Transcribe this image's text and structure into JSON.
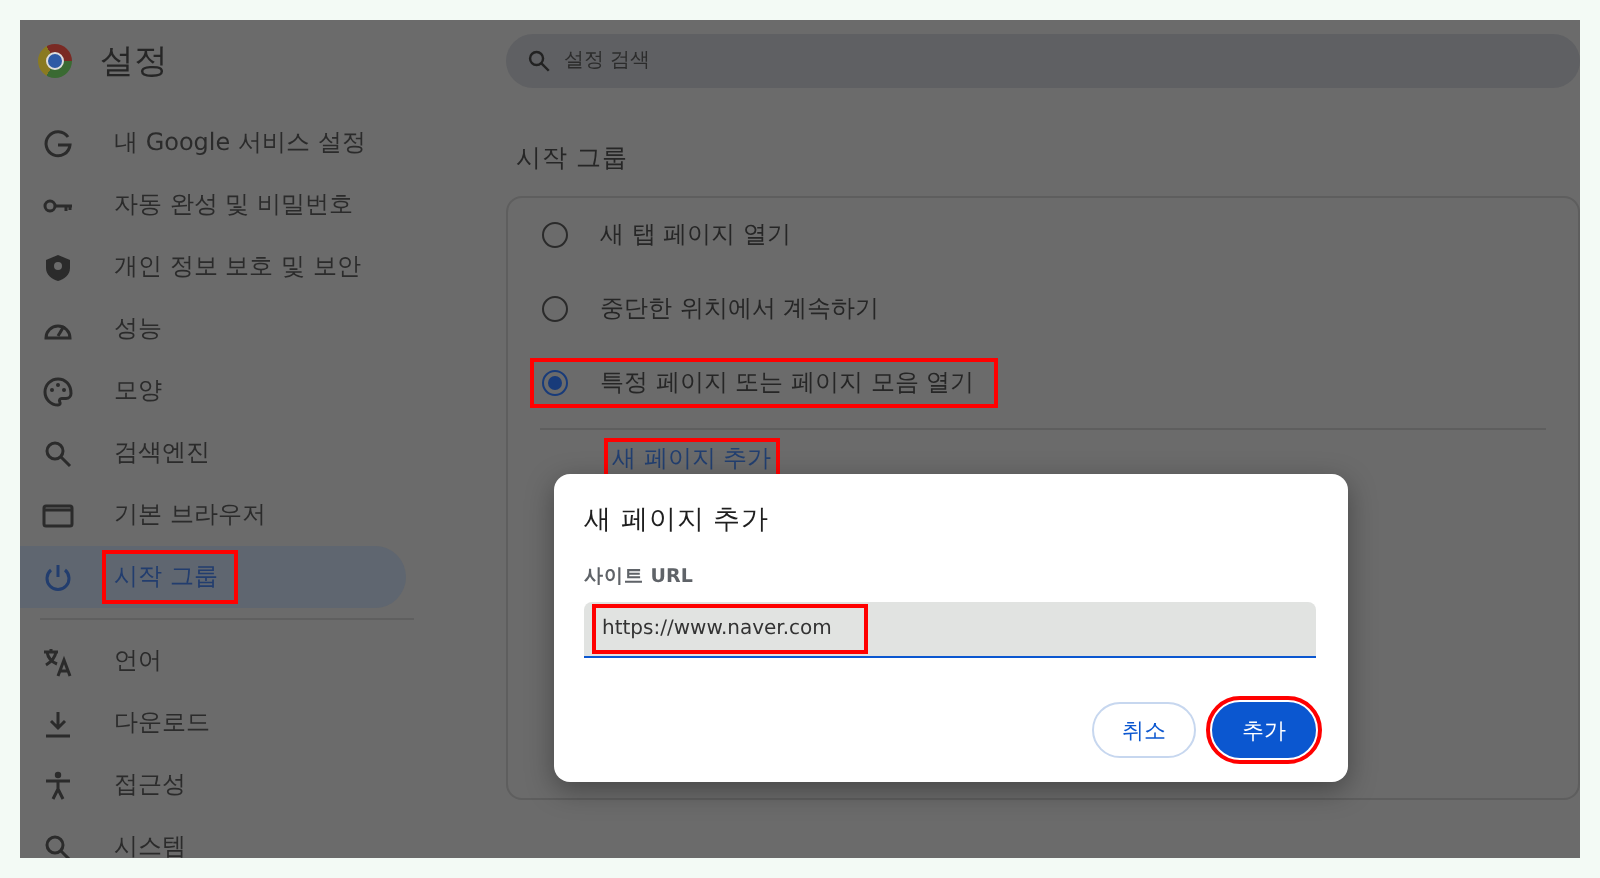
{
  "app": {
    "title": "설정"
  },
  "search": {
    "placeholder": "설정 검색"
  },
  "sidebar": {
    "sections": [
      {
        "items": [
          {
            "label": "내 Google 서비스 설정",
            "selected": false,
            "highlighted": false
          },
          {
            "label": "자동 완성 및 비밀번호",
            "selected": false,
            "highlighted": false
          },
          {
            "label": "개인 정보 보호 및 보안",
            "selected": false,
            "highlighted": false
          },
          {
            "label": "성능",
            "selected": false,
            "highlighted": false
          },
          {
            "label": "모양",
            "selected": false,
            "highlighted": false
          },
          {
            "label": "검색엔진",
            "selected": false,
            "highlighted": false
          },
          {
            "label": "기본 브라우저",
            "selected": false,
            "highlighted": false
          },
          {
            "label": "시작 그룹",
            "selected": true,
            "highlighted": true
          }
        ]
      },
      {
        "items": [
          {
            "label": "언어",
            "selected": false,
            "highlighted": false
          },
          {
            "label": "다운로드",
            "selected": false,
            "highlighted": false
          },
          {
            "label": "접근성",
            "selected": false,
            "highlighted": false
          },
          {
            "label": "시스템",
            "selected": false,
            "highlighted": false
          }
        ]
      }
    ]
  },
  "section": {
    "title": "시작 그룹",
    "options": [
      {
        "label": "새 탭 페이지 열기",
        "selected": false,
        "highlighted": false
      },
      {
        "label": "중단한 위치에서 계속하기",
        "selected": false,
        "highlighted": false
      },
      {
        "label": "특정 페이지 또는 페이지 모음 열기",
        "selected": true,
        "highlighted": true
      }
    ],
    "add_link": {
      "label": "새 페이지 추가",
      "highlighted": true
    }
  },
  "dialog": {
    "title": "새 페이지 추가",
    "field": {
      "label": "사이트 URL",
      "value": "https://www.naver.com",
      "highlighted": true
    },
    "buttons": [
      {
        "label": "취소",
        "kind": "secondary",
        "highlighted": false
      },
      {
        "label": "추가",
        "kind": "primary",
        "highlighted": true
      }
    ]
  }
}
